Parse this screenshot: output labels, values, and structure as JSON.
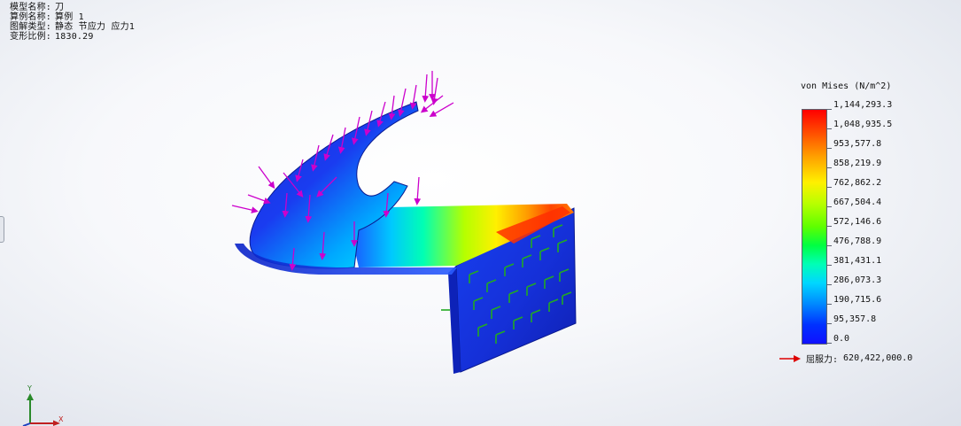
{
  "info": {
    "model_name_label": "模型名称:",
    "model_name_value": "刀",
    "study_name_label": "算例名称:",
    "study_name_value": "算例 1",
    "plot_type_label": "图解类型:",
    "plot_type_value": "静态 节应力 应力1",
    "deformation_label": "变形比例:",
    "deformation_value": "1830.29"
  },
  "legend": {
    "title": "von Mises (N/m^2)",
    "ticks": [
      "1,144,293.3",
      "1,048,935.5",
      "953,577.8",
      "858,219.9",
      "762,862.2",
      "667,504.4",
      "572,146.6",
      "476,788.9",
      "381,431.1",
      "286,073.3",
      "190,715.6",
      "95,357.8",
      "0.0"
    ],
    "yield_label": "屈服力:",
    "yield_value": "620,422,000.0"
  },
  "triad": {
    "y_label": "Y",
    "x_label": "X"
  },
  "colors": {
    "max": "#ff0000",
    "min": "#1010ff",
    "load_arrows": "#cc00cc",
    "fixture_arrows": "#22aa22",
    "yield_arrow": "#dd0000"
  },
  "icons": {
    "load_arrow": "pressure-arrow-icon",
    "fixture": "fixed-geometry-icon",
    "yield_marker": "red-arrow-icon",
    "triad": "axis-triad-icon"
  }
}
